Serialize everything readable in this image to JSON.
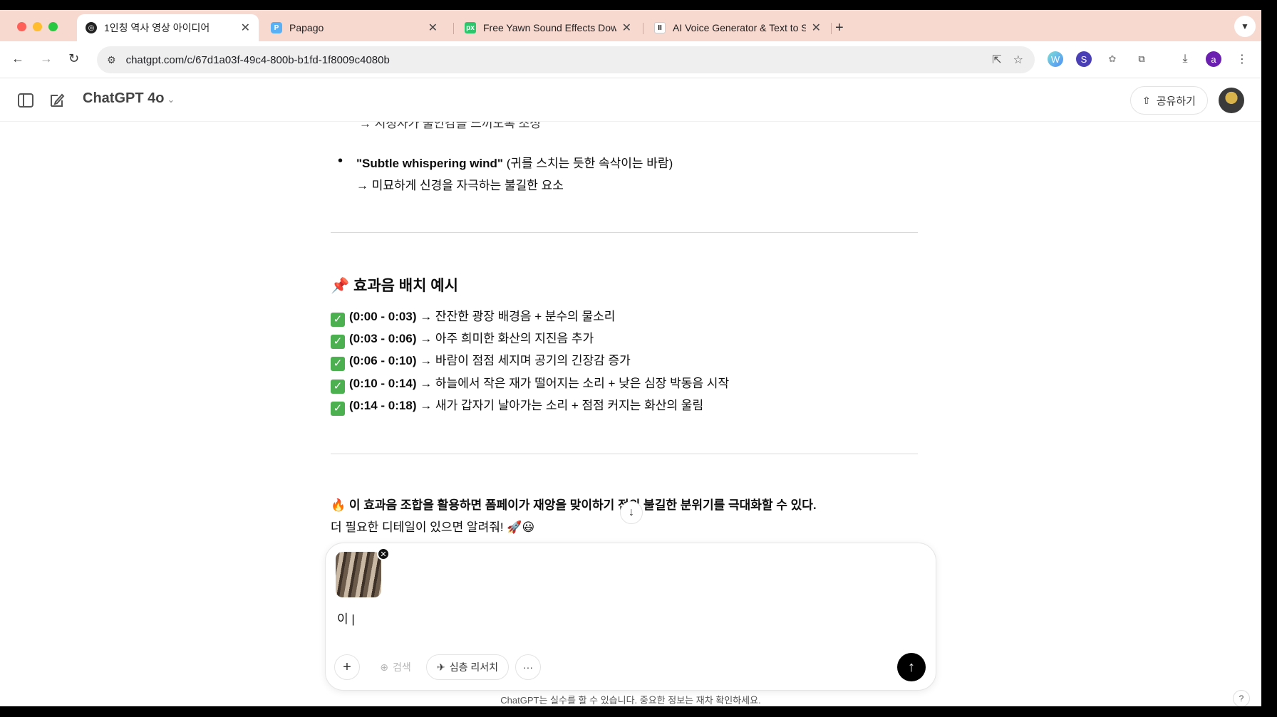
{
  "browser": {
    "tabs": [
      {
        "title": "1인칭 역사 영상 아이디어",
        "active": true,
        "icon": "chatgpt-icon"
      },
      {
        "title": "Papago",
        "active": false,
        "icon": "papago-icon"
      },
      {
        "title": "Free Yawn Sound Effects Dow",
        "active": false,
        "icon": "pixabay-icon"
      },
      {
        "title": "AI Voice Generator & Text to S",
        "active": false,
        "icon": "elevenlabs-icon"
      }
    ],
    "url": "chatgpt.com/c/67d1a03f-49c4-800b-b1fd-1f8009c4080b",
    "profile_initial": "a"
  },
  "app": {
    "model_label": "ChatGPT 4o",
    "share_label": "공유하기"
  },
  "message": {
    "clipped_line": "→ 시청자가 불안감을 느끼도록 조성",
    "bullet_bold": "\"Subtle whispering wind\"",
    "bullet_rest": " (귀를 스치는 듯한 속삭이는 바람)",
    "bullet_sub": "→ 미묘하게 신경을 자극하는 불길한 요소",
    "heading_emoji": "📌",
    "heading": "효과음 배치 예시",
    "timeline": [
      {
        "time": "(0:00 - 0:03)",
        "desc": " → 잔잔한 광장 배경음 + 분수의 물소리"
      },
      {
        "time": "(0:03 - 0:06)",
        "desc": " → 아주 희미한 화산의 지진음 추가"
      },
      {
        "time": "(0:06 - 0:10)",
        "desc": " → 바람이 점점 세지며 공기의 긴장감 증가"
      },
      {
        "time": "(0:10 - 0:14)",
        "desc": " → 하늘에서 작은 재가 떨어지는 소리 + 낮은 심장 박동음 시작"
      },
      {
        "time": "(0:14 - 0:18)",
        "desc": " → 새가 갑자기 날아가는 소리 + 점점 커지는 화산의 울림"
      }
    ],
    "closing_emoji": "🔥",
    "closing_bold": "이 효과음 조합을 활용하면 폼페이가 재앙을 맞이하기 전의 불길한 분위기를 극대화할 수 있다.",
    "closing_second": "더 필요한 디테일이 있으면 알려줘! 🚀😃"
  },
  "composer": {
    "typed_text": "이 |",
    "search_label": "검색",
    "research_label": "심층 리서치"
  },
  "footer": {
    "disclaimer": "ChatGPT는 실수를 할 수 있습니다. 중요한 정보는 재차 확인하세요.",
    "help": "?"
  },
  "colors": {
    "tabbar": "#f7d9d0",
    "send_button": "#000000",
    "check": "#4caf50"
  }
}
